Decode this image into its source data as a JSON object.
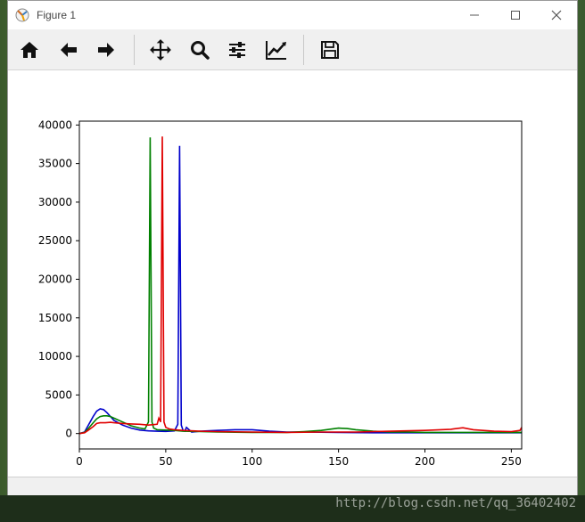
{
  "window": {
    "title": "Figure 1",
    "minimize_icon": "minimize-icon",
    "maximize_icon": "maximize-icon",
    "close_icon": "close-icon"
  },
  "toolbar": {
    "buttons": [
      {
        "name": "home-button",
        "icon": "home-icon"
      },
      {
        "name": "back-button",
        "icon": "arrow-left-icon"
      },
      {
        "name": "forward-button",
        "icon": "arrow-right-icon"
      },
      {
        "name": "pan-button",
        "icon": "move-icon"
      },
      {
        "name": "zoom-button",
        "icon": "search-icon"
      },
      {
        "name": "configure-subplots-button",
        "icon": "sliders-icon"
      },
      {
        "name": "edit-axis-button",
        "icon": "line-chart-icon"
      },
      {
        "name": "save-button",
        "icon": "save-icon"
      }
    ]
  },
  "watermark": "http://blog.csdn.net/qq_36402402",
  "chart_data": {
    "type": "line",
    "xlim": [
      0,
      256
    ],
    "ylim": [
      -2000,
      40500
    ],
    "xticks": [
      0,
      50,
      100,
      150,
      200,
      250
    ],
    "yticks": [
      0,
      5000,
      10000,
      15000,
      20000,
      25000,
      30000,
      35000,
      40000
    ],
    "grid": false,
    "series": [
      {
        "color": "#0000cc",
        "x": [
          0,
          3,
          5,
          8,
          10,
          12,
          14,
          16,
          18,
          20,
          25,
          30,
          35,
          40,
          45,
          50,
          55,
          57,
          58,
          59,
          60,
          61,
          62,
          65,
          70,
          80,
          90,
          100,
          110,
          120,
          130,
          150,
          170,
          190,
          210,
          230,
          250,
          256
        ],
        "y": [
          0,
          200,
          1000,
          2200,
          2900,
          3200,
          3100,
          2700,
          2200,
          1700,
          1100,
          700,
          450,
          350,
          300,
          280,
          350,
          1200,
          37300,
          1100,
          400,
          300,
          800,
          200,
          300,
          400,
          500,
          500,
          300,
          200,
          200,
          150,
          100,
          100,
          100,
          100,
          100,
          100
        ]
      },
      {
        "color": "#008000",
        "x": [
          0,
          3,
          5,
          8,
          10,
          12,
          14,
          16,
          18,
          20,
          22,
          25,
          30,
          35,
          38,
          40,
          41,
          42,
          43,
          44,
          45,
          50,
          55,
          60,
          70,
          80,
          100,
          120,
          130,
          140,
          150,
          155,
          160,
          170,
          180,
          190,
          200,
          220,
          240,
          256
        ],
        "y": [
          0,
          150,
          600,
          1400,
          1900,
          2200,
          2300,
          2300,
          2200,
          2000,
          1800,
          1500,
          1000,
          700,
          600,
          1500,
          38400,
          1500,
          700,
          600,
          500,
          450,
          400,
          300,
          250,
          200,
          150,
          150,
          250,
          400,
          700,
          650,
          500,
          300,
          200,
          200,
          150,
          150,
          150,
          150
        ]
      },
      {
        "color": "#e00000",
        "x": [
          0,
          3,
          5,
          8,
          10,
          12,
          15,
          18,
          20,
          25,
          30,
          35,
          40,
          45,
          46,
          47,
          48,
          49,
          50,
          52,
          55,
          60,
          70,
          80,
          100,
          120,
          140,
          160,
          180,
          200,
          215,
          222,
          228,
          240,
          250,
          255,
          256
        ],
        "y": [
          0,
          100,
          400,
          900,
          1300,
          1400,
          1400,
          1450,
          1400,
          1300,
          1250,
          1200,
          1100,
          1200,
          2000,
          1500,
          38500,
          1500,
          800,
          600,
          500,
          400,
          300,
          250,
          200,
          150,
          200,
          200,
          300,
          400,
          550,
          750,
          500,
          300,
          250,
          400,
          800
        ]
      }
    ]
  }
}
